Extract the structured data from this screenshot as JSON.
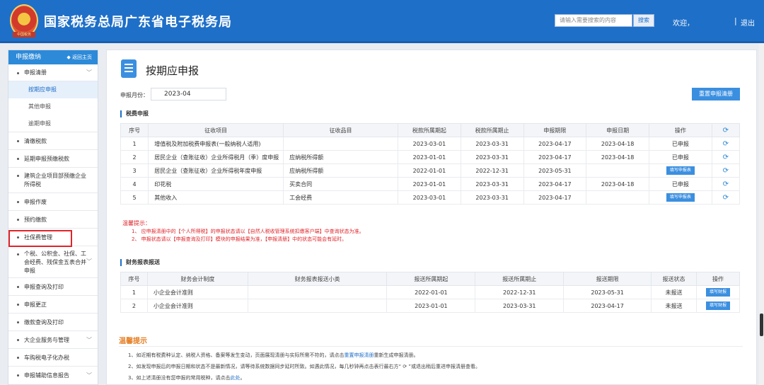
{
  "header": {
    "site_title": "国家税务总局广东省电子税务局",
    "emblem_text": "中国税务",
    "search_placeholder": "请输入需要搜索的内容",
    "search_button": "搜索",
    "welcome": "欢迎，",
    "divider": "|",
    "logout": "退出"
  },
  "sidebar": {
    "title": "申报缴纳",
    "back_label": "返回主页",
    "items": [
      {
        "label": "申报清册",
        "expanded": true,
        "children": [
          "按期应申报",
          "其他申报",
          "逾期申报"
        ],
        "active_child": "按期应申报"
      },
      {
        "label": "清缴税款"
      },
      {
        "label": "延期申报预缴税款"
      },
      {
        "label": "建筑企业项目部预缴企业所得税"
      },
      {
        "label": "申报作废"
      },
      {
        "label": "预约缴款"
      },
      {
        "label": "社保费管理"
      },
      {
        "label": "个税、公积金、社保、工会经费、残保金五表合并申报"
      },
      {
        "label": "申报查询及打印"
      },
      {
        "label": "申报更正"
      },
      {
        "label": "缴款查询及打印"
      },
      {
        "label": "大企业服务与管理"
      },
      {
        "label": "车购税电子化办税"
      },
      {
        "label": "申报辅助信息报告"
      }
    ]
  },
  "main": {
    "page_title": "按期应申报",
    "period_label": "申报月份：",
    "period_value": "2023-04",
    "reset_button": "重置申报清册",
    "tax_section": {
      "title": "税费申报",
      "columns": [
        "序号",
        "征收项目",
        "征收品目",
        "税款所属期起",
        "税款所属期止",
        "申报期限",
        "申报日期",
        "操作"
      ],
      "rows": [
        {
          "no": "1",
          "item": "增值税及附加税费申报表(一般纳税人适用)",
          "subitem": "",
          "start": "2023-03-01",
          "end": "2023-03-31",
          "deadline": "2023-04-17",
          "date": "2023-04-18",
          "op": "已申报",
          "op_button": false
        },
        {
          "no": "2",
          "item": "居民企业（查账征收）企业所得税月（季）度申报",
          "subitem": "应纳税所得额",
          "start": "2023-01-01",
          "end": "2023-03-31",
          "deadline": "2023-04-17",
          "date": "2023-04-18",
          "op": "已申报",
          "op_button": false
        },
        {
          "no": "3",
          "item": "居民企业（查账征收）企业所得税年度申报",
          "subitem": "应纳税所得额",
          "start": "2022-01-01",
          "end": "2022-12-31",
          "deadline": "2023-05-31",
          "date": "",
          "op": "填写申报表",
          "op_button": true
        },
        {
          "no": "4",
          "item": "印花税",
          "subitem": "买卖合同",
          "start": "2023-01-01",
          "end": "2023-03-31",
          "deadline": "2023-04-17",
          "date": "2023-04-18",
          "op": "已申报",
          "op_button": false
        },
        {
          "no": "5",
          "item": "其他收入",
          "subitem": "工会经费",
          "start": "2023-03-01",
          "end": "2023-03-31",
          "deadline": "2023-04-17",
          "date": "",
          "op": "填写申报表",
          "op_button": true
        }
      ]
    },
    "notice": {
      "title": "温馨提示：",
      "lines": [
        "1、 应申报清册中的【个人所得税】的申报状态请以【自然人税收管理系统扣缴客户端】中查询状态为准。",
        "2、 申报状态请以【申报查询及打印】模块的申报结果为准，【申报清册】中的状态可能会有延时。"
      ]
    },
    "finance_section": {
      "title": "财务报表报送",
      "columns": [
        "序号",
        "财务会计制度",
        "财务报表报送小类",
        "报送所属期起",
        "报送所属期止",
        "报送期限",
        "报送状态",
        "操作"
      ],
      "rows": [
        {
          "no": "1",
          "system": "小企业会计准则",
          "category": "",
          "start": "2022-01-01",
          "end": "2022-12-31",
          "deadline": "2023-05-31",
          "status": "未报送",
          "op": "填写财报"
        },
        {
          "no": "2",
          "system": "小企业会计准则",
          "category": "",
          "start": "2023-01-01",
          "end": "2023-03-31",
          "deadline": "2023-04-17",
          "status": "未报送",
          "op": "填写财报"
        }
      ]
    },
    "tips": {
      "title": "温馨提示",
      "line1_a": "1、如近期有税费种认定、纳税人资格、备案等发生变动，页面展现清册与实际所需不符的，请点击",
      "line1_link": "重置申报清册",
      "line1_b": "重新生成申报清册。",
      "line2": "2、如发现申报后的申报日期和状态不是最新情况，请等待系统数据同步延时所致。如遇此情况，每几秒钟再点击表行最右方“ ⟳ ”或退出稍后重进申报清册查看。",
      "line3_a": "3、如上述清册没有您申报的常用税种，请点击",
      "line3_link": "此处",
      "line3_b": "。"
    }
  },
  "colors": {
    "header_blue": "#1e6fc8",
    "button_blue": "#3b8fe0",
    "alert_red": "#e0242a",
    "tips_orange": "#e67e22"
  }
}
